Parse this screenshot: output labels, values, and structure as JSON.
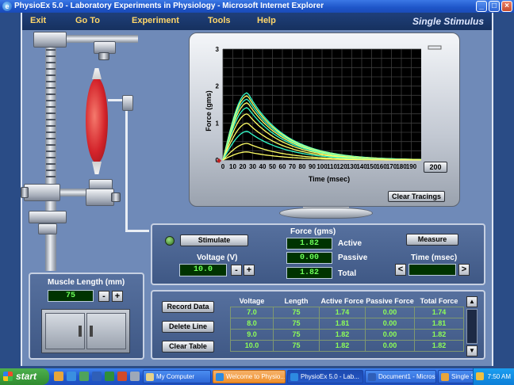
{
  "window": {
    "title": "PhysioEx 5.0 - Laboratory Experiments in Physiology - Microsoft Internet Explorer",
    "minimize": "_",
    "maximize": "□",
    "close": "×"
  },
  "menu": {
    "items": [
      {
        "label": "Exit"
      },
      {
        "label": "Go To"
      },
      {
        "label": "Experiment"
      },
      {
        "label": "Tools"
      },
      {
        "label": "Help"
      }
    ],
    "mode_title": "Single Stimulus"
  },
  "chart_data": {
    "type": "line",
    "ylabel": "Force (gms)",
    "xlabel": "Time (msec)",
    "xlim": [
      0,
      200
    ],
    "ylim": [
      0,
      3
    ],
    "x_ticks": [
      0,
      10,
      20,
      30,
      40,
      50,
      60,
      70,
      80,
      90,
      100,
      110,
      120,
      130,
      140,
      150,
      160,
      170,
      180,
      190
    ],
    "y_ticks": [
      0,
      1,
      2,
      3
    ],
    "grid": true,
    "x_end_button": "200",
    "series": [
      {
        "peak": 1.82,
        "color": "#33ffcc"
      },
      {
        "peak": 1.74,
        "color": "#ffff66"
      },
      {
        "peak": 1.65,
        "color": "#33ffcc"
      },
      {
        "peak": 1.55,
        "color": "#ffff66"
      },
      {
        "peak": 1.42,
        "color": "#33ffcc"
      },
      {
        "peak": 1.25,
        "color": "#ffff66"
      },
      {
        "peak": 1.0,
        "color": "#ffff66"
      },
      {
        "peak": 0.78,
        "color": "#33ffcc"
      },
      {
        "peak": 0.45,
        "color": "#ffff66"
      },
      {
        "peak": 0.22,
        "color": "#ffff66"
      }
    ]
  },
  "controls": {
    "clear_tracings": "Clear Tracings",
    "stimulate": "Stimulate",
    "voltage_label": "Voltage (V)",
    "voltage_value": "10.0",
    "minus": "-",
    "plus": "+",
    "force_label": "Force (gms)",
    "active_label": "Active",
    "active_value": "1.82",
    "passive_label": "Passive",
    "passive_value": "0.00",
    "total_label": "Total",
    "total_value": "1.82",
    "measure": "Measure",
    "time_label": "Time (msec)",
    "time_value": "",
    "left_arrow": "<",
    "right_arrow": ">"
  },
  "muscle_length": {
    "label": "Muscle Length (mm)",
    "value": "75"
  },
  "record": {
    "record_data": "Record Data",
    "delete_line": "Delete Line",
    "clear_table": "Clear Table",
    "scroll_up": "▲",
    "scroll_down": "▼"
  },
  "table": {
    "headers": [
      "Voltage",
      "Length",
      "Active Force",
      "Passive Force",
      "Total Force"
    ],
    "rows": [
      [
        "7.0",
        "75",
        "1.74",
        "0.00",
        "1.74"
      ],
      [
        "8.0",
        "75",
        "1.81",
        "0.00",
        "1.81"
      ],
      [
        "9.0",
        "75",
        "1.82",
        "0.00",
        "1.82"
      ],
      [
        "10.0",
        "75",
        "1.82",
        "0.00",
        "1.82"
      ]
    ]
  },
  "taskbar": {
    "start": "start",
    "tasks": [
      {
        "label": "My Computer"
      },
      {
        "label": "Welcome to Physio..."
      },
      {
        "label": "PhysioEx 5.0 - Lab..."
      },
      {
        "label": "Document1 - Micros..."
      },
      {
        "label": "Single Stimulus"
      }
    ],
    "clock": "7:50 AM"
  }
}
